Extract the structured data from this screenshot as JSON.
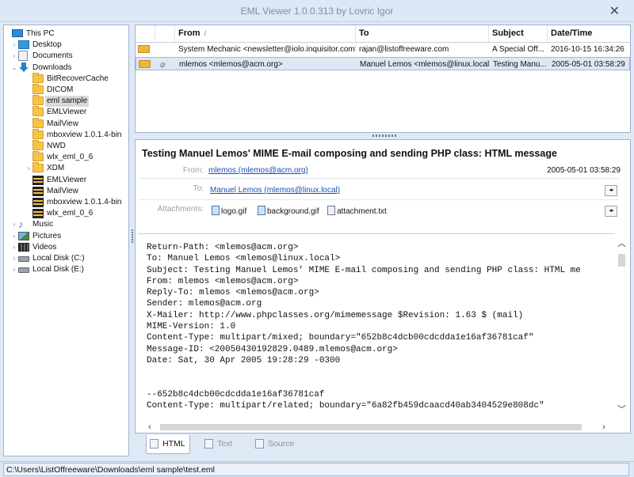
{
  "window": {
    "title": "EML Viewer 1.0.0.313 by Lovric Igor",
    "close_glyph": "✕"
  },
  "tree": {
    "items": [
      {
        "label": "This PC",
        "icon": "pc-icon",
        "level": 0,
        "arrow": ""
      },
      {
        "label": "Desktop",
        "icon": "desktop-icon",
        "level": 1,
        "arrow": ">"
      },
      {
        "label": "Documents",
        "icon": "documents-icon",
        "level": 1,
        "arrow": ">"
      },
      {
        "label": "Downloads",
        "icon": "downloads-icon",
        "level": 1,
        "arrow": "v"
      },
      {
        "label": "BitRecoverCache",
        "icon": "folder-icon",
        "level": 2,
        "arrow": ""
      },
      {
        "label": "DICOM",
        "icon": "folder-icon",
        "level": 2,
        "arrow": ""
      },
      {
        "label": "eml sample",
        "icon": "folder-icon",
        "level": 2,
        "arrow": "",
        "selected": true
      },
      {
        "label": "EMLViewer",
        "icon": "folder-icon",
        "level": 2,
        "arrow": ""
      },
      {
        "label": "MailView",
        "icon": "folder-icon",
        "level": 2,
        "arrow": ""
      },
      {
        "label": "mboxview 1.0.1.4-bin",
        "icon": "folder-icon",
        "level": 2,
        "arrow": ""
      },
      {
        "label": "NWD",
        "icon": "folder-icon",
        "level": 2,
        "arrow": ""
      },
      {
        "label": "wlx_eml_0_6",
        "icon": "folder-icon",
        "level": 2,
        "arrow": ""
      },
      {
        "label": "XDM",
        "icon": "folder-icon",
        "level": 2,
        "arrow": ">"
      },
      {
        "label": "EMLViewer",
        "icon": "archive-icon",
        "level": 2,
        "arrow": ""
      },
      {
        "label": "MailView",
        "icon": "archive-icon",
        "level": 2,
        "arrow": ""
      },
      {
        "label": "mboxview 1.0.1.4-bin",
        "icon": "archive-icon",
        "level": 2,
        "arrow": ""
      },
      {
        "label": "wlx_eml_0_6",
        "icon": "archive-icon",
        "level": 2,
        "arrow": ""
      },
      {
        "label": "Music",
        "icon": "music-icon",
        "level": 1,
        "arrow": ">"
      },
      {
        "label": "Pictures",
        "icon": "pictures-icon",
        "level": 1,
        "arrow": ">"
      },
      {
        "label": "Videos",
        "icon": "videos-icon",
        "level": 1,
        "arrow": ">"
      },
      {
        "label": "Local Disk (C:)",
        "icon": "disk-icon",
        "level": 1,
        "arrow": ">"
      },
      {
        "label": "Local Disk (E:)",
        "icon": "disk-icon",
        "level": 1,
        "arrow": ">"
      }
    ]
  },
  "list": {
    "columns": [
      "From",
      "To",
      "Subject",
      "Date/Time"
    ],
    "sort_indicator": "/",
    "rows": [
      {
        "from": "System Mechanic <newsletter@iolo.inquisitor.com>",
        "to": "rajan@listoffreeware.com",
        "subject": "A Special Off...",
        "date": "2016-10-15 16:34:26",
        "attachment": false
      },
      {
        "from": "mlemos <mlemos@acm.org>",
        "to": "Manuel Lemos <mlemos@linux.local>",
        "subject": "Testing Manu...",
        "date": "2005-05-01 03:58:29",
        "attachment": true
      }
    ]
  },
  "message": {
    "subject": "Testing Manuel Lemos' MIME E-mail composing and sending PHP class: HTML message",
    "from_label": "From:",
    "from_value": "mlemos (mlemos@acm.org)",
    "date": "2005-05-01 03:58:29",
    "to_label": "To:",
    "to_value": "Manuel Lemos (mlemos@linux.local)",
    "attachments_label": "Attachments:",
    "attachments": [
      "logo.gif",
      "background.gif",
      "attachment.txt"
    ],
    "body": [
      "Return-Path: <mlemos@acm.org>",
      "To: Manuel Lemos <mlemos@linux.local>",
      "Subject: Testing Manuel Lemos' MIME E-mail composing and sending PHP class: HTML me",
      "From: mlemos <mlemos@acm.org>",
      "Reply-To: mlemos <mlemos@acm.org>",
      "Sender: mlemos@acm.org",
      "X-Mailer: http://www.phpclasses.org/mimemessage $Revision: 1.63 $ (mail)",
      "MIME-Version: 1.0",
      "Content-Type: multipart/mixed; boundary=\"652b8c4dcb00cdcdda1e16af36781caf\"",
      "Message-ID: <20050430192829.0489.mlemos@acm.org>",
      "Date: Sat, 30 Apr 2005 19:28:29 -0300",
      "",
      "",
      "--652b8c4dcb00cdcdda1e16af36781caf",
      "Content-Type: multipart/related; boundary=\"6a82fb459dcaacd40ab3404529e808dc\""
    ]
  },
  "tabs": [
    {
      "label": "HTML",
      "active": true
    },
    {
      "label": "Text",
      "active": false
    },
    {
      "label": "Source",
      "active": false
    }
  ],
  "status": {
    "path": "C:\\Users\\ListOffreeware\\Downloads\\eml sample\\test.eml"
  }
}
